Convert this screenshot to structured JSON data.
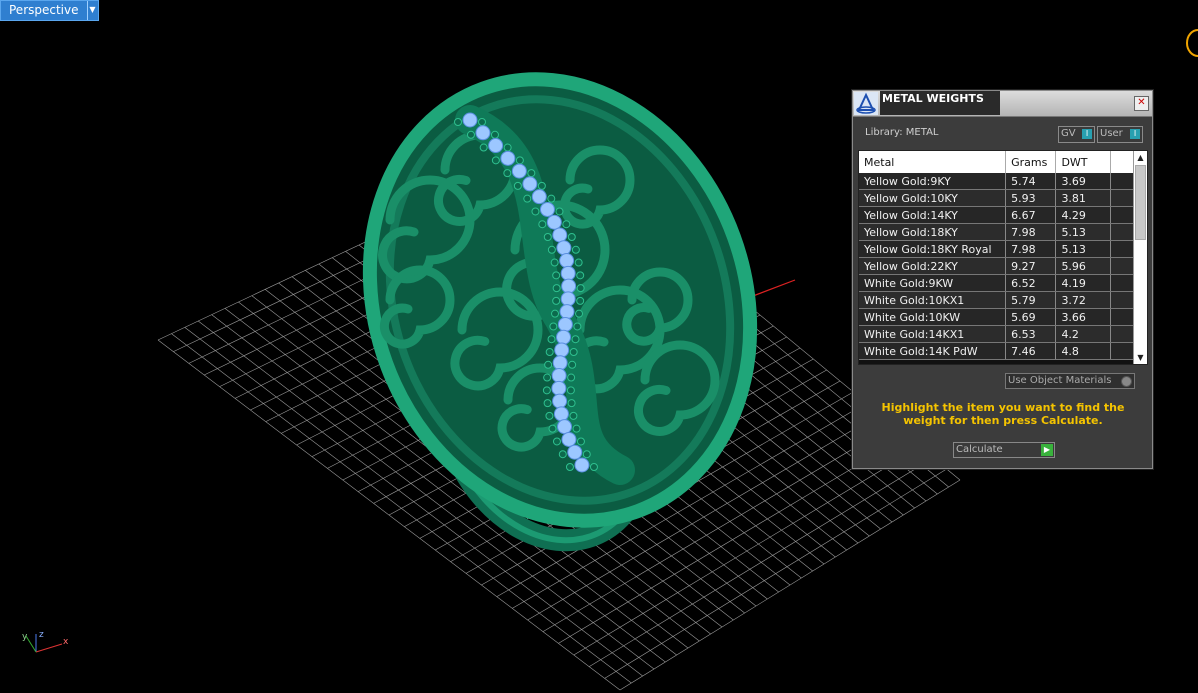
{
  "viewport": {
    "view_name": "Perspective",
    "axis": {
      "x": "x",
      "y": "y",
      "z": "z"
    }
  },
  "panel": {
    "title": "METAL WEIGHTS",
    "library_label": "Library: METAL",
    "toggle_gv": "GV",
    "toggle_user": "User",
    "columns": [
      "Metal",
      "Grams",
      "DWT"
    ],
    "rows": [
      {
        "metal": "Yellow Gold:9KY",
        "grams": "5.74",
        "dwt": "3.69"
      },
      {
        "metal": "Yellow Gold:10KY",
        "grams": "5.93",
        "dwt": "3.81"
      },
      {
        "metal": "Yellow Gold:14KY",
        "grams": "6.67",
        "dwt": "4.29"
      },
      {
        "metal": "Yellow Gold:18KY",
        "grams": "7.98",
        "dwt": "5.13"
      },
      {
        "metal": "Yellow Gold:18KY Royal",
        "grams": "7.98",
        "dwt": "5.13"
      },
      {
        "metal": "Yellow Gold:22KY",
        "grams": "9.27",
        "dwt": "5.96"
      },
      {
        "metal": "White Gold:9KW",
        "grams": "6.52",
        "dwt": "4.19"
      },
      {
        "metal": "White Gold:10KX1",
        "grams": "5.79",
        "dwt": "3.72"
      },
      {
        "metal": "White Gold:10KW",
        "grams": "5.69",
        "dwt": "3.66"
      },
      {
        "metal": "White Gold:14KX1",
        "grams": "6.53",
        "dwt": "4.2"
      },
      {
        "metal": "White Gold:14K PdW",
        "grams": "7.46",
        "dwt": "4.8"
      }
    ],
    "use_object_materials": "Use Object Materials",
    "hint": "Highlight the item you want to find the weight for then press Calculate.",
    "calculate": "Calculate"
  }
}
